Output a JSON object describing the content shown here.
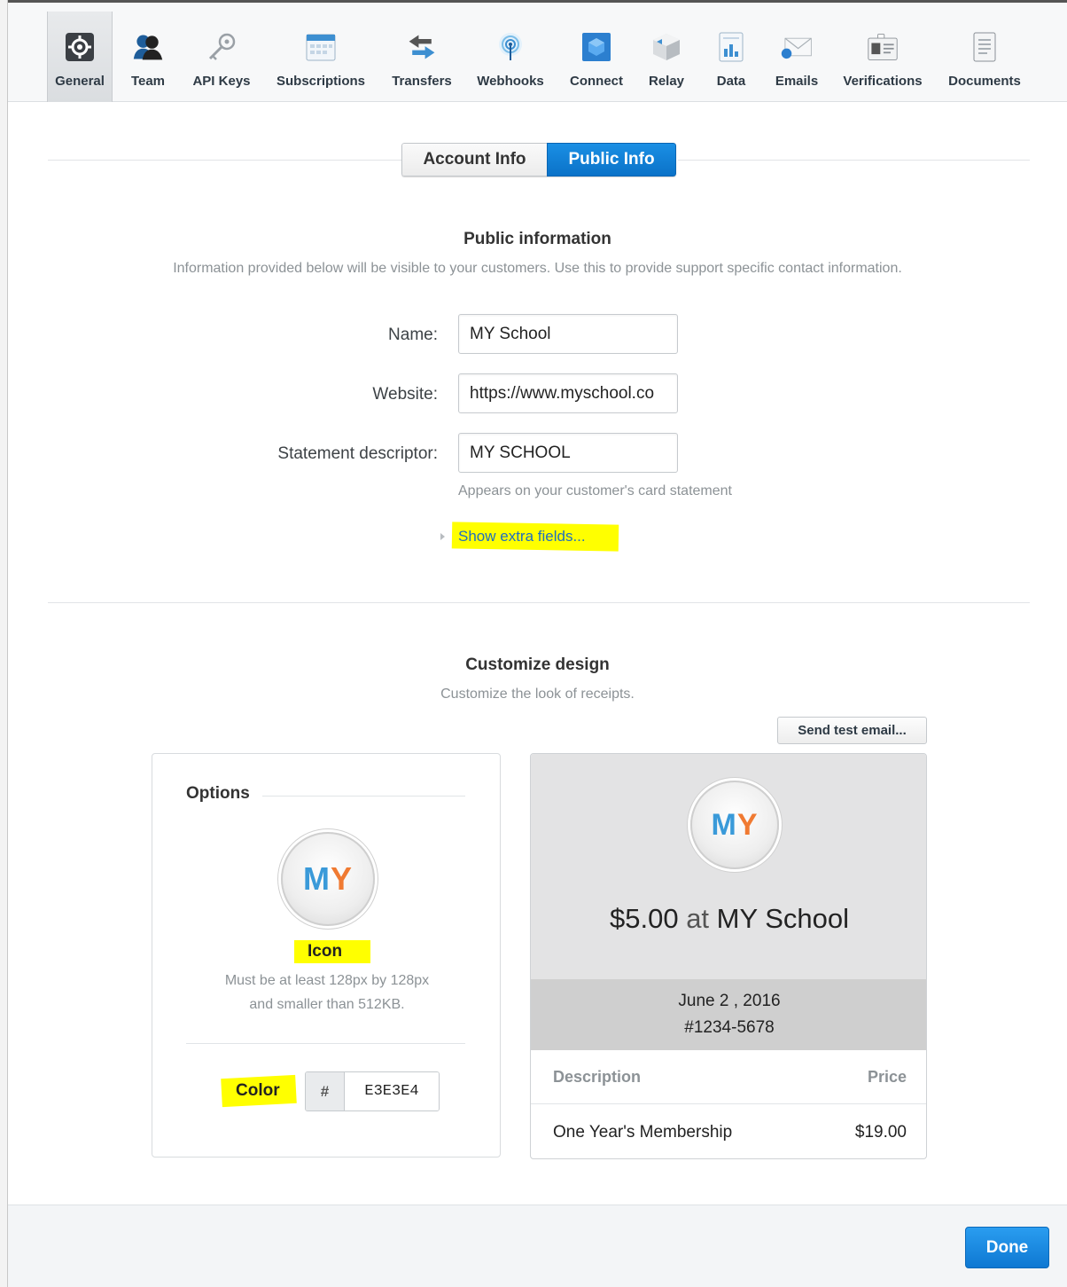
{
  "toolbar": {
    "tabs": [
      {
        "label": "General",
        "icon": "gear-icon"
      },
      {
        "label": "Team",
        "icon": "team-icon"
      },
      {
        "label": "API Keys",
        "icon": "key-icon"
      },
      {
        "label": "Subscriptions",
        "icon": "calendar-icon"
      },
      {
        "label": "Transfers",
        "icon": "transfer-arrows-icon"
      },
      {
        "label": "Webhooks",
        "icon": "webhook-icon"
      },
      {
        "label": "Connect",
        "icon": "connect-cube-icon"
      },
      {
        "label": "Relay",
        "icon": "relay-box-icon"
      },
      {
        "label": "Data",
        "icon": "data-chart-icon"
      },
      {
        "label": "Emails",
        "icon": "email-icon"
      },
      {
        "label": "Verifications",
        "icon": "id-card-icon"
      },
      {
        "label": "Documents",
        "icon": "document-icon"
      }
    ],
    "active": "General"
  },
  "segments": {
    "account": "Account Info",
    "public": "Public Info",
    "selected": "Public Info"
  },
  "public_info": {
    "title": "Public information",
    "subtitle": "Information provided below will be visible to your customers. Use this to provide support specific contact information.",
    "name_label": "Name:",
    "name_value": "MY School",
    "website_label": "Website:",
    "website_value": "https://www.myschool.co",
    "descriptor_label": "Statement descriptor:",
    "descriptor_value": "MY SCHOOL",
    "descriptor_help": "Appears on your customer's card statement",
    "extra_link": "Show extra fields..."
  },
  "design": {
    "title": "Customize design",
    "subtitle": "Customize the look of receipts.",
    "send_test": "Send test email..."
  },
  "options": {
    "title": "Options",
    "logo_m": "M",
    "logo_y": "Y",
    "icon_label": "Icon",
    "icon_help_1": "Must be at least 128px by 128px",
    "icon_help_2": "and smaller than 512KB.",
    "color_label": "Color",
    "color_prefix": "#",
    "color_value": "E3E3E4"
  },
  "receipt": {
    "amount": "$5.00",
    "at": "at",
    "merchant": "MY School",
    "date": "June 2  , 2016",
    "number": "#1234-5678",
    "col_description": "Description",
    "col_price": "Price",
    "item_description": "One Year's Membership",
    "item_price": "$19.00",
    "header_color": "#E3E3E4"
  },
  "footer": {
    "done": "Done"
  },
  "colors": {
    "accent": "#0e78d2",
    "highlight": "#ffff00"
  }
}
